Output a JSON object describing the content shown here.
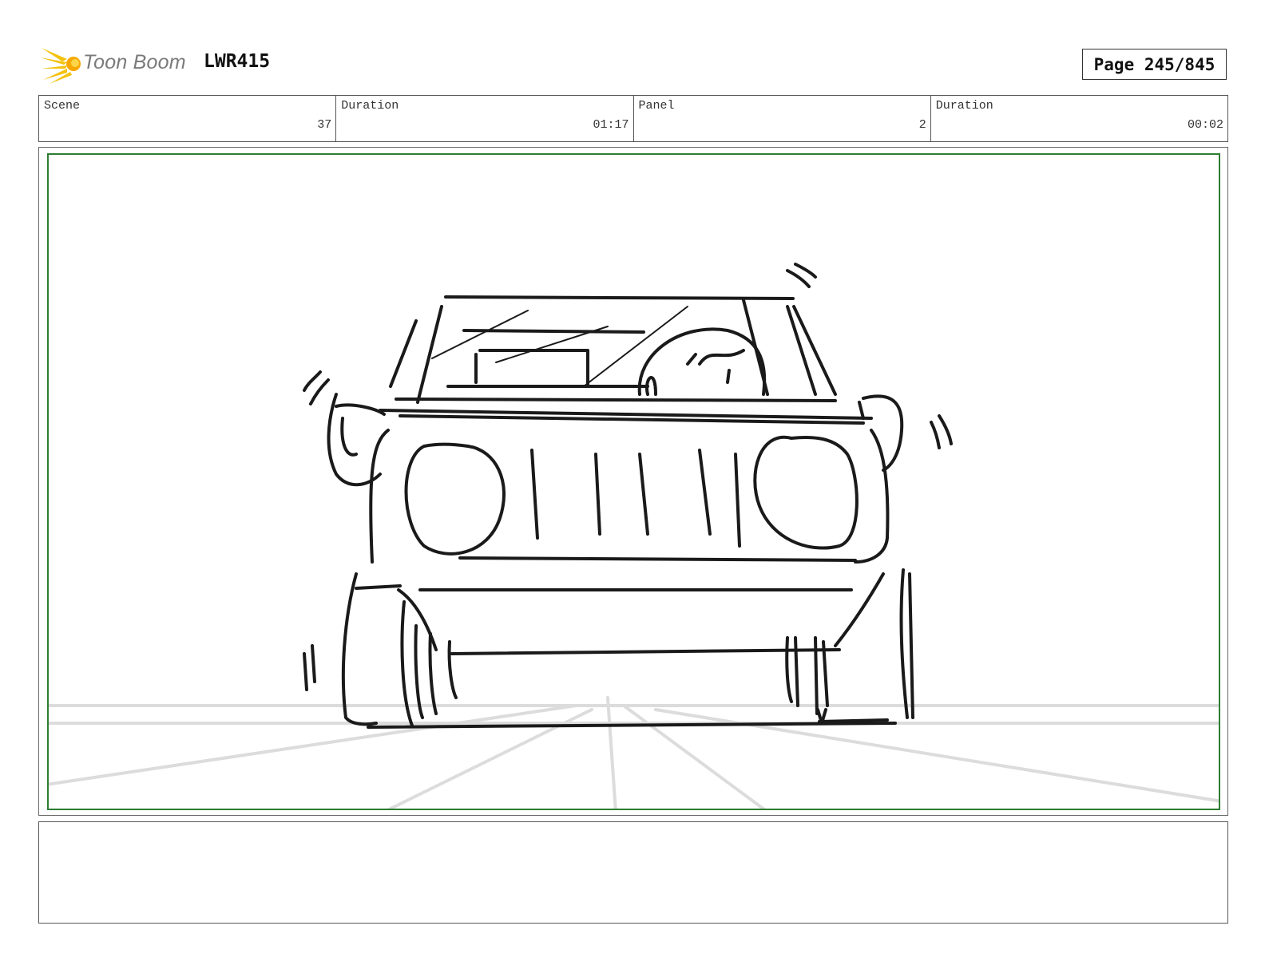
{
  "header": {
    "logo_text": "Toon Boom",
    "project_code": "LWR415",
    "page_label": "Page 245/845"
  },
  "info": [
    {
      "label": "Scene",
      "value": "37"
    },
    {
      "label": "Duration",
      "value": "01:17"
    },
    {
      "label": "Panel",
      "value": "2"
    },
    {
      "label": "Duration",
      "value": "00:02"
    }
  ],
  "panel": {
    "frame_color": "#2e7d32",
    "sketch": "rough storyboard sketch: front view of a car with a driver, on a road with perspective guide lines"
  },
  "notes": {
    "text": ""
  }
}
